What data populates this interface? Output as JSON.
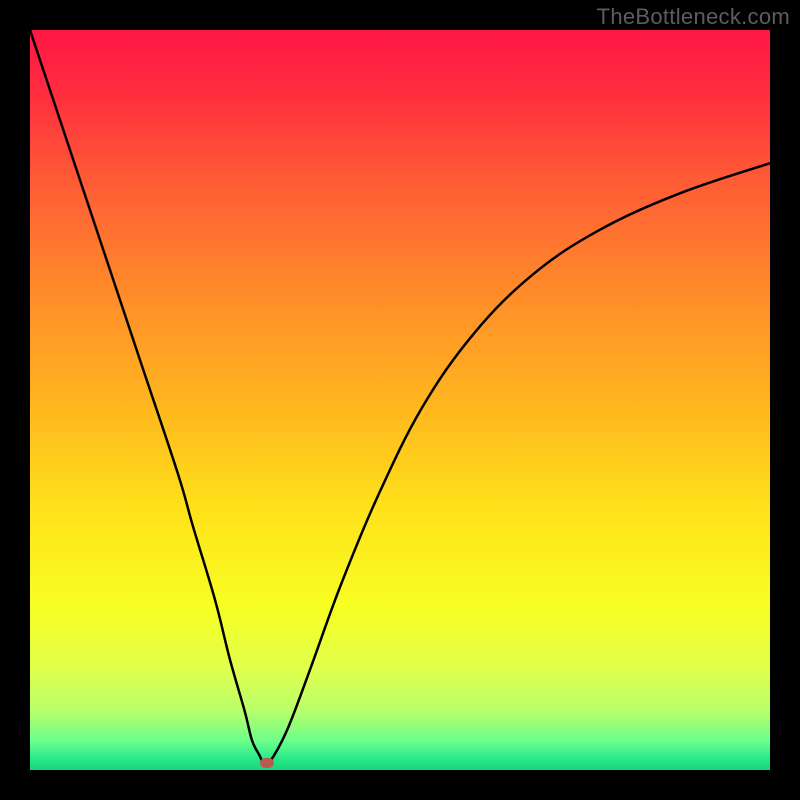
{
  "watermark": "TheBottleneck.com",
  "chart_data": {
    "type": "line",
    "title": "",
    "xlabel": "",
    "ylabel": "",
    "xlim": [
      0,
      100
    ],
    "ylim": [
      0,
      100
    ],
    "grid": false,
    "series": [
      {
        "name": "bottleneck-curve",
        "x": [
          0,
          5,
          10,
          15,
          20,
          22,
          25,
          27,
          29,
          30,
          31,
          31.5,
          32,
          33,
          35,
          38,
          42,
          47,
          53,
          60,
          68,
          77,
          88,
          100
        ],
        "values": [
          100,
          85,
          70,
          55,
          40,
          33,
          23,
          15,
          8,
          4,
          2,
          1,
          1,
          2,
          6,
          14,
          25,
          37,
          49,
          59,
          67,
          73,
          78,
          82
        ]
      }
    ],
    "annotations": [
      {
        "name": "minimum-marker",
        "x": 32,
        "y": 1,
        "color": "#bb5a4e"
      }
    ],
    "background": {
      "type": "vertical-gradient",
      "stops": [
        {
          "pos": 0.0,
          "color": "#ff1744"
        },
        {
          "pos": 0.08,
          "color": "#ff2b3f"
        },
        {
          "pos": 0.2,
          "color": "#ff5a36"
        },
        {
          "pos": 0.35,
          "color": "#ff8a2a"
        },
        {
          "pos": 0.5,
          "color": "#ffb41f"
        },
        {
          "pos": 0.65,
          "color": "#ffe21a"
        },
        {
          "pos": 0.78,
          "color": "#f7ff23"
        },
        {
          "pos": 0.86,
          "color": "#e2ff4a"
        },
        {
          "pos": 0.92,
          "color": "#b8ff6a"
        },
        {
          "pos": 0.96,
          "color": "#6cff8a"
        },
        {
          "pos": 0.985,
          "color": "#28e98a"
        },
        {
          "pos": 1.0,
          "color": "#17d67a"
        }
      ]
    },
    "curve_color": "#000000",
    "curve_width": 2.5
  }
}
